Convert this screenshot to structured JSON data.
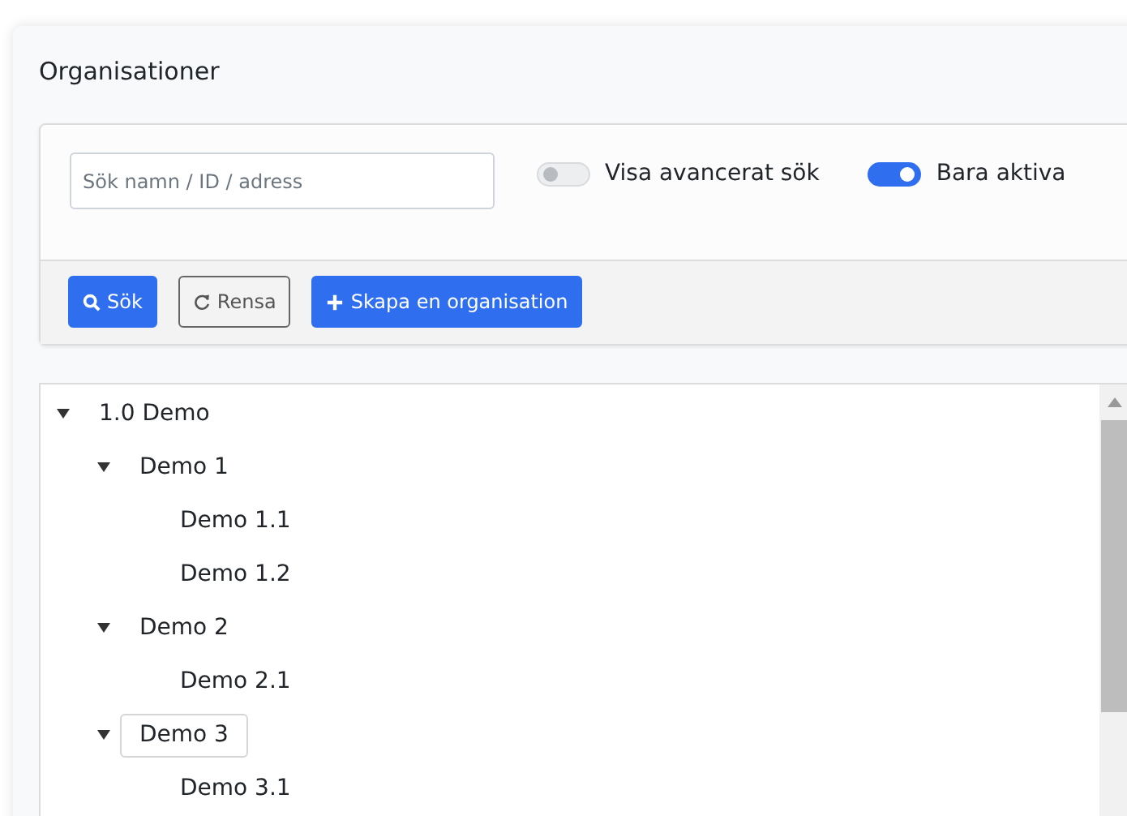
{
  "title": "Organisationer",
  "search": {
    "placeholder": "Sök namn / ID / adress"
  },
  "toggles": [
    {
      "label": "Visa avancerat sök",
      "on": false
    },
    {
      "label": "Bara aktiva",
      "on": true
    }
  ],
  "buttons": [
    {
      "label": "Sök",
      "kind": "search"
    },
    {
      "label": "Rensa",
      "kind": "reset"
    },
    {
      "label": "Skapa en organisation",
      "kind": "create"
    }
  ],
  "tree": [
    {
      "label": "1.0 Demo",
      "expanded": true,
      "selected": false,
      "children": [
        {
          "label": "Demo 1",
          "expanded": true,
          "selected": false,
          "children": [
            {
              "label": "Demo 1.1",
              "selected": false
            },
            {
              "label": "Demo 1.2",
              "selected": false
            }
          ]
        },
        {
          "label": "Demo 2",
          "expanded": true,
          "selected": false,
          "children": [
            {
              "label": "Demo 2.1",
              "selected": false
            }
          ]
        },
        {
          "label": "Demo 3",
          "expanded": true,
          "selected": true,
          "children": [
            {
              "label": "Demo 3.1",
              "selected": false
            }
          ]
        }
      ]
    }
  ]
}
